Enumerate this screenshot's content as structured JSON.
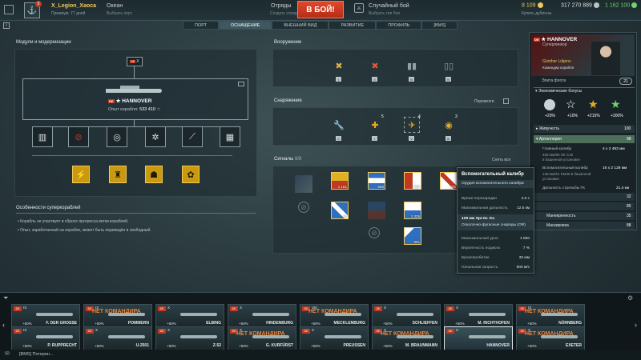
{
  "topbar": {
    "player_name": "X_Legion_Xaoca",
    "player_premium": "Премиум: 77 дней",
    "notifications": "5",
    "server": "Океан",
    "server_sub": "Выбрать порт",
    "squads": "Отряды",
    "squads_sub": "Создать отряд",
    "battle_button": "В БОЙ!",
    "mode": "Случайный бой",
    "mode_sub": "Выбрать тип боя",
    "doubloons": "8 109",
    "doubloons_sub": "Купить дублоны",
    "credits": "317 270 889",
    "free_xp": "1 162 100"
  },
  "tabs": [
    "ПОРТ",
    "ОСНАЩЕНИЕ",
    "ВНЕШНИЙ ВИД",
    "РАЗВИТИЕ",
    "ПРОФИЛЬ",
    "[BMS]"
  ],
  "modules": {
    "title": "Модули и модернизации",
    "tier_label": "X",
    "ship_name": "HANNOVER",
    "ship_xp_label": "Опыт корабля:",
    "ship_xp": "533 410"
  },
  "superships": {
    "title": "Особенности суперкораблей",
    "notes": [
      "Корабль не участвует в сбросе прогресса ветки кораблей.",
      "Опыт, заработанный на корабле, может быть переведён в свободный."
    ]
  },
  "armament": {
    "title": "Вооружение",
    "levels": [
      "I",
      "II",
      "III",
      "IV"
    ]
  },
  "equipment": {
    "title": "Снаряжение",
    "rearm": "Перевезти",
    "levels": [
      "II",
      "I",
      "V",
      "III"
    ],
    "counts": [
      "",
      "5",
      "4",
      "3"
    ]
  },
  "signals": {
    "title": "Сигналы",
    "count": "8/8",
    "remove_all": "Снять все",
    "items": [
      "1 161",
      "595",
      "864",
      "509",
      "44",
      "1 325",
      "861"
    ]
  },
  "tooltip": {
    "title": "Вспомогательный калибр",
    "subtitle": "Орудия вспомогательного калибра",
    "reload_label": "Время перезарядки",
    "reload": "4.0 с",
    "range_label": "Максимальная дальность",
    "range": "12.5 км",
    "shell_title": "128 мм Spr.Gr. Kz.",
    "shell_type": "Осколочно-фугасные снаряды (ОФ)",
    "dmg_label": "Максимальный урон",
    "dmg": "1 500",
    "fire_label": "Вероятность поджога",
    "fire": "7 %",
    "pen_label": "Бронепробитие",
    "pen": "32 мм",
    "vel_label": "Начальная скорость",
    "vel": "900 м/с"
  },
  "ship_card": {
    "tier": "X",
    "name": "HANNOVER",
    "type": "Суперлинкор",
    "commander": "Günther Lütjens",
    "commander_sub": "Командир корабля",
    "elite": "Элита флота",
    "skill_points": "21",
    "economy_title": "Экономические бонусы",
    "bonuses": [
      "+20%",
      "+10%",
      "+215%",
      "+300%"
    ],
    "survivability_label": "Живучесть",
    "survivability": "100",
    "artillery_label": "Артиллерия",
    "artillery": "98",
    "main_cal_label": "Главный калибр",
    "main_cal": "4 x 2  483 мм",
    "main_cal_gun": "483-мм/50 SK C42",
    "main_cal_mount": "в башенной установке",
    "sec_cal_label": "Вспомогательный калибр",
    "sec_cal": "16 x 2  128 мм",
    "sec_cal_gun": "128-мм/61 KM40 в башенной",
    "sec_cal_mount": "установке",
    "range_label": "Дальность стрельбы ГК",
    "range": "21.4 км",
    "v1": "32",
    "v2": "85",
    "v3": "10",
    "maneuver_label": "Маневренность",
    "v4": "35",
    "conceal_label": "Маскировка",
    "v5": "88"
  },
  "carousel": [
    {
      "tier": "IX",
      "name": "F. DER GROSSE",
      "bonus": "+50%",
      "nocmd": ""
    },
    {
      "tier": "IX",
      "name": "POMMERN",
      "bonus": "+50%",
      "nocmd": "НЕТ КОМАНДИРА"
    },
    {
      "tier": "X",
      "name": "ELBING",
      "bonus": "+50%",
      "nocmd": ""
    },
    {
      "tier": "X",
      "name": "HINDENBURG",
      "bonus": "+50%",
      "nocmd": ""
    },
    {
      "tier": "VIII",
      "name": "MECKLENBURG",
      "bonus": "+50%",
      "nocmd": "НЕТ КОМАНДИРА"
    },
    {
      "tier": "X",
      "name": "SCHLIEFFEN",
      "bonus": "+50%",
      "nocmd": ""
    },
    {
      "tier": "X",
      "name": "M. RICHTHOFEN",
      "bonus": "+50%",
      "nocmd": ""
    },
    {
      "tier": "IX",
      "name": "NÜRNBERG",
      "bonus": "+50%",
      "nocmd": "НЕТ КОМАНДИРА"
    },
    {
      "tier": "IX",
      "name": "P. RUPPRECHT",
      "bonus": "+50%",
      "nocmd": ""
    },
    {
      "tier": "X",
      "name": "U-2501",
      "bonus": "+50%",
      "nocmd": ""
    },
    {
      "tier": "X",
      "name": "Z-52",
      "bonus": "+50%",
      "nocmd": ""
    },
    {
      "tier": "X",
      "name": "G. KURFÜRST",
      "bonus": "+50%",
      "nocmd": "НЕТ КОМАНДИРА"
    },
    {
      "tier": "X",
      "name": "PREUSSEN",
      "bonus": "+50%",
      "nocmd": ""
    },
    {
      "tier": "X",
      "name": "M. BRAUNMANN",
      "bonus": "+50%",
      "nocmd": "НЕТ КОМАНДИРА"
    },
    {
      "tier": "X",
      "name": "HANNOVER",
      "bonus": "",
      "nocmd": ""
    },
    {
      "tier": "X",
      "name": "EXETER",
      "bonus": "+50%",
      "nocmd": "НЕТ КОМАНДИРА"
    }
  ],
  "chat": "[BMS] Потерян..."
}
